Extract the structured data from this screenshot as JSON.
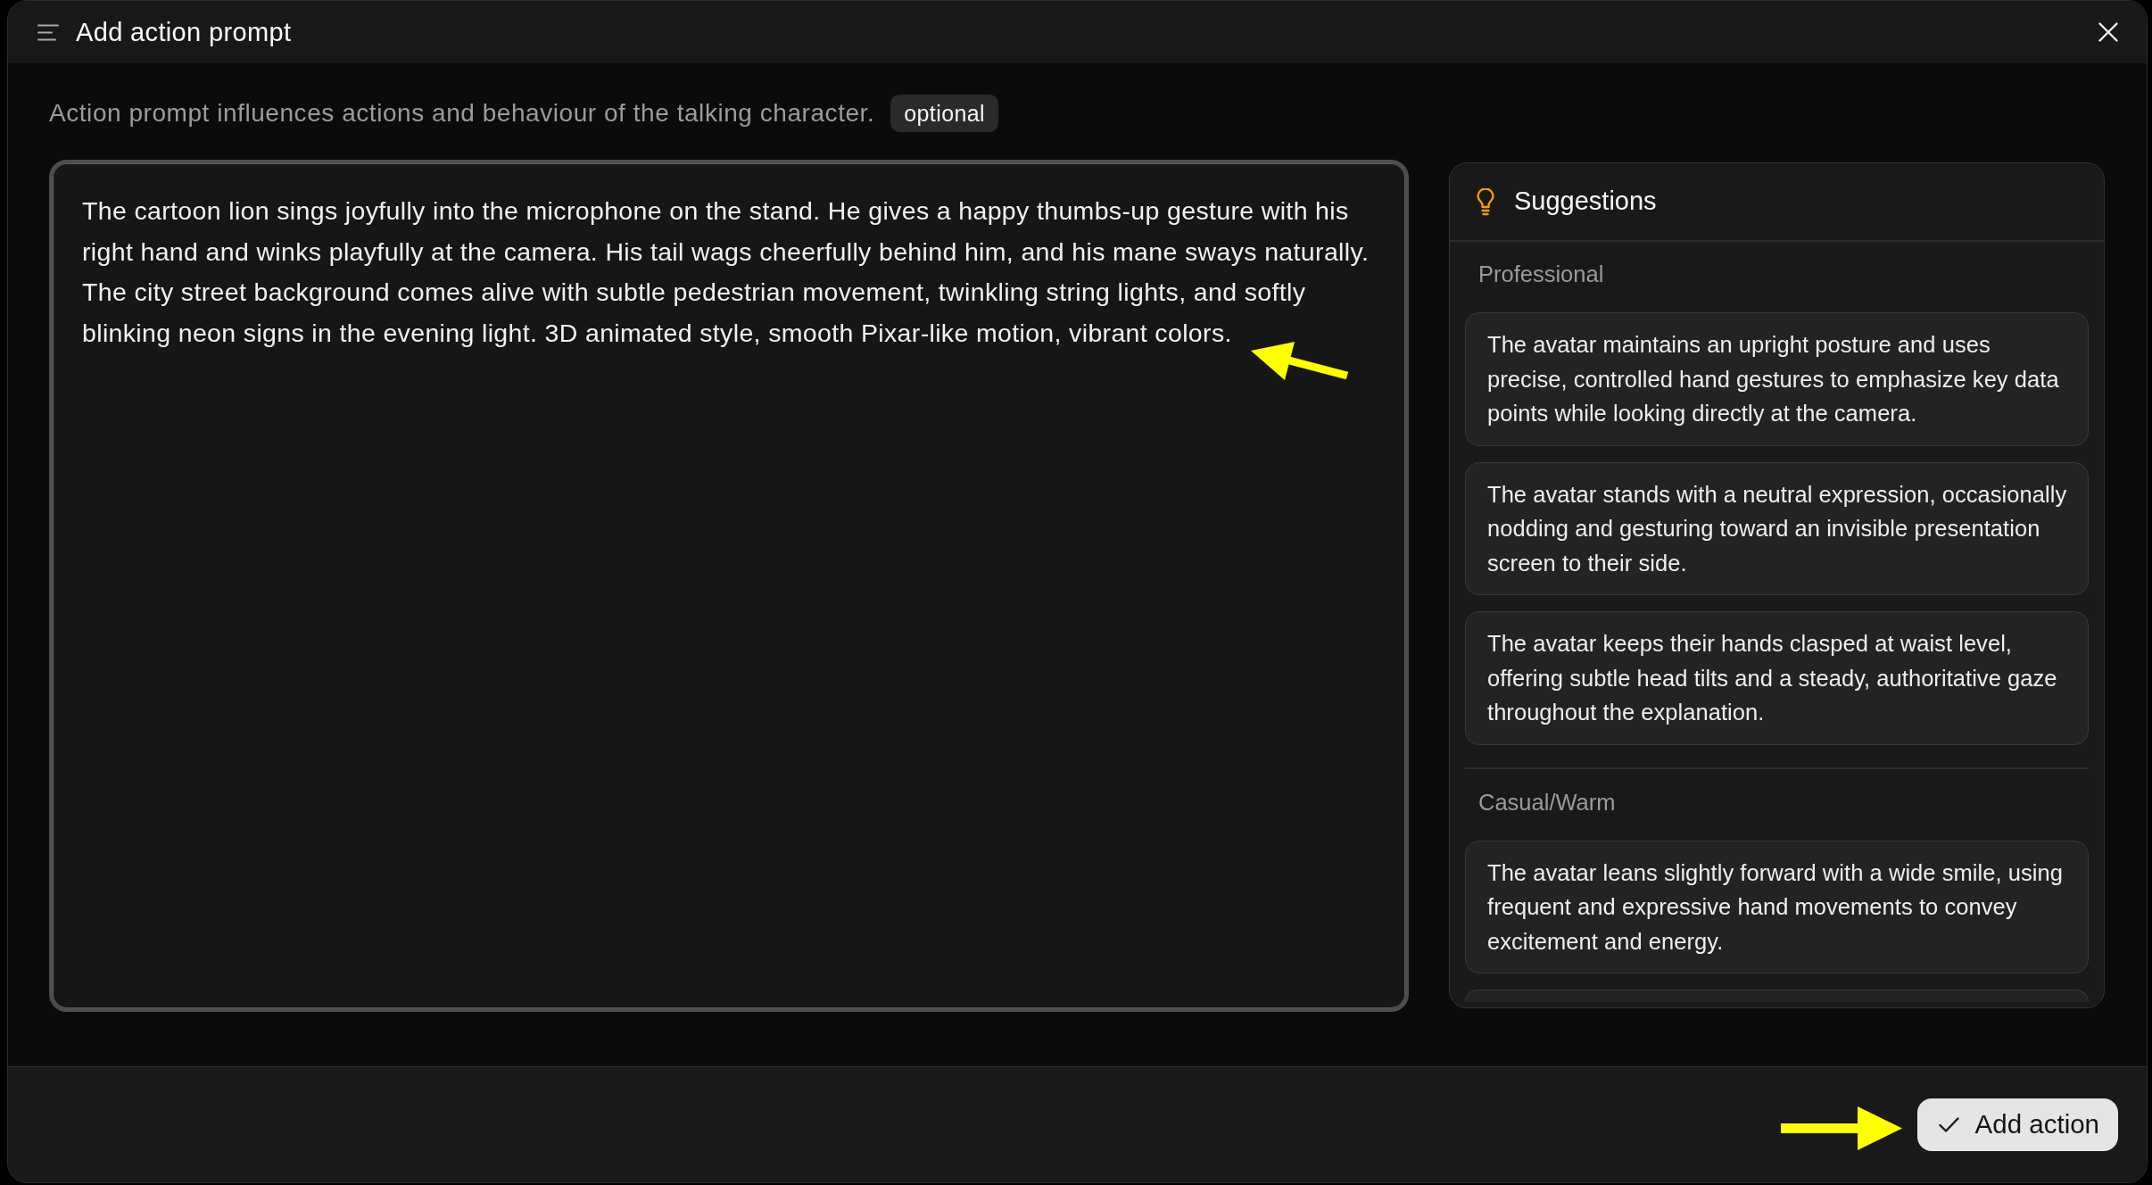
{
  "dialog": {
    "title": "Add action prompt",
    "description": "Action prompt influences actions and behaviour of the talking character.",
    "badge": "optional"
  },
  "prompt": {
    "value": "The cartoon lion sings joyfully into the microphone on the stand. He gives a happy thumbs-up gesture with his right hand and winks playfully at the camera. His tail wags cheerfully behind him, and his mane sways naturally. The city street background comes alive with subtle pedestrian movement, twinkling string lights, and softly blinking neon signs in the evening light. 3D animated style, smooth Pixar-like motion, vibrant colors."
  },
  "suggestions": {
    "title": "Suggestions",
    "groups": [
      {
        "label": "Professional",
        "items": [
          "The avatar maintains an upright posture and uses precise, controlled hand gestures to emphasize key data points while looking directly at the camera.",
          "The avatar stands with a neutral expression, occasionally nodding and gesturing toward an invisible presentation screen to their side.",
          "The avatar keeps their hands clasped at waist level, offering subtle head tilts and a steady, authoritative gaze throughout the explanation."
        ]
      },
      {
        "label": "Casual/Warm",
        "items": [
          "The avatar leans slightly forward with a wide smile, using frequent and expressive hand movements to convey excitement and energy."
        ]
      }
    ],
    "more_below": true
  },
  "footer": {
    "primary_button": "Add action"
  }
}
